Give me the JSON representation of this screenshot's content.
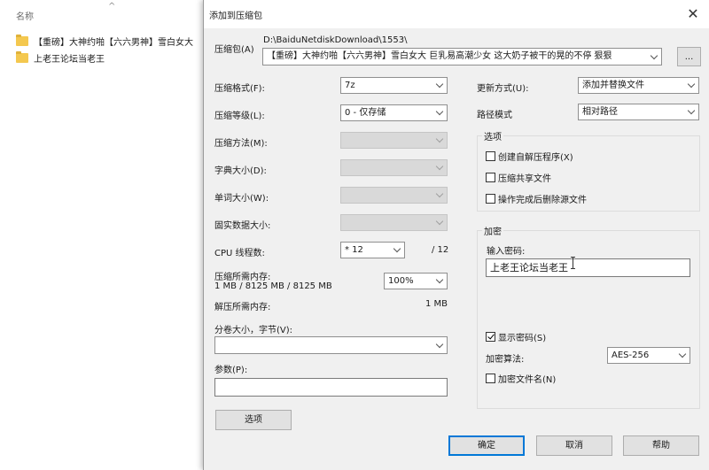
{
  "explorer": {
    "column_header": "名称",
    "files": [
      {
        "name": "【重磅】大神约啪【六六男神】雪白女大"
      },
      {
        "name": "上老王论坛当老王"
      }
    ]
  },
  "dialog": {
    "title": "添加到压缩包",
    "archive": {
      "label": "压缩包(A)",
      "path": "D:\\BaiduNetdiskDownload\\1553\\",
      "filename": "【重磅】大神约啪【六六男神】雪白女大 巨乳易高潮少女 这大奶子被干的晃的不停 狠狠",
      "browse_label": "..."
    },
    "left": {
      "format": {
        "label": "压缩格式(F):",
        "value": "7z"
      },
      "level": {
        "label": "压缩等级(L):",
        "value": "0 - 仅存储"
      },
      "method": {
        "label": "压缩方法(M):",
        "value": ""
      },
      "dict": {
        "label": "字典大小(D):",
        "value": ""
      },
      "word": {
        "label": "单词大小(W):",
        "value": ""
      },
      "solid": {
        "label": "固实数据大小:",
        "value": ""
      },
      "cpu": {
        "label": "CPU 线程数:",
        "value": "* 12",
        "total": "/ 12"
      },
      "mem_compress": {
        "label": "压缩所需内存:",
        "detail": "1 MB / 8125 MB / 8125 MB",
        "percent": "100%"
      },
      "mem_decompress": {
        "label": "解压所需内存:",
        "value": "1 MB"
      },
      "split": {
        "label": "分卷大小，字节(V):",
        "value": ""
      },
      "params": {
        "label": "参数(P):",
        "value": ""
      },
      "options_button": "选项"
    },
    "right": {
      "update": {
        "label": "更新方式(U):",
        "value": "添加并替换文件"
      },
      "path_mode": {
        "label": "路径模式",
        "value": "相对路径"
      },
      "options_group": {
        "title": "选项",
        "sfx": {
          "label": "创建自解压程序(X)",
          "checked": false
        },
        "shared": {
          "label": "压缩共享文件",
          "checked": false
        },
        "delete": {
          "label": "操作完成后删除源文件",
          "checked": false
        }
      },
      "encryption": {
        "title": "加密",
        "password_label": "输入密码:",
        "password_value": "上老王论坛当老王",
        "show_password": {
          "label": "显示密码(S)",
          "checked": true
        },
        "method_label": "加密算法:",
        "method_value": "AES-256",
        "encrypt_names": {
          "label": "加密文件名(N)",
          "checked": false
        }
      }
    },
    "buttons": {
      "ok": "确定",
      "cancel": "取消",
      "help": "帮助"
    }
  }
}
